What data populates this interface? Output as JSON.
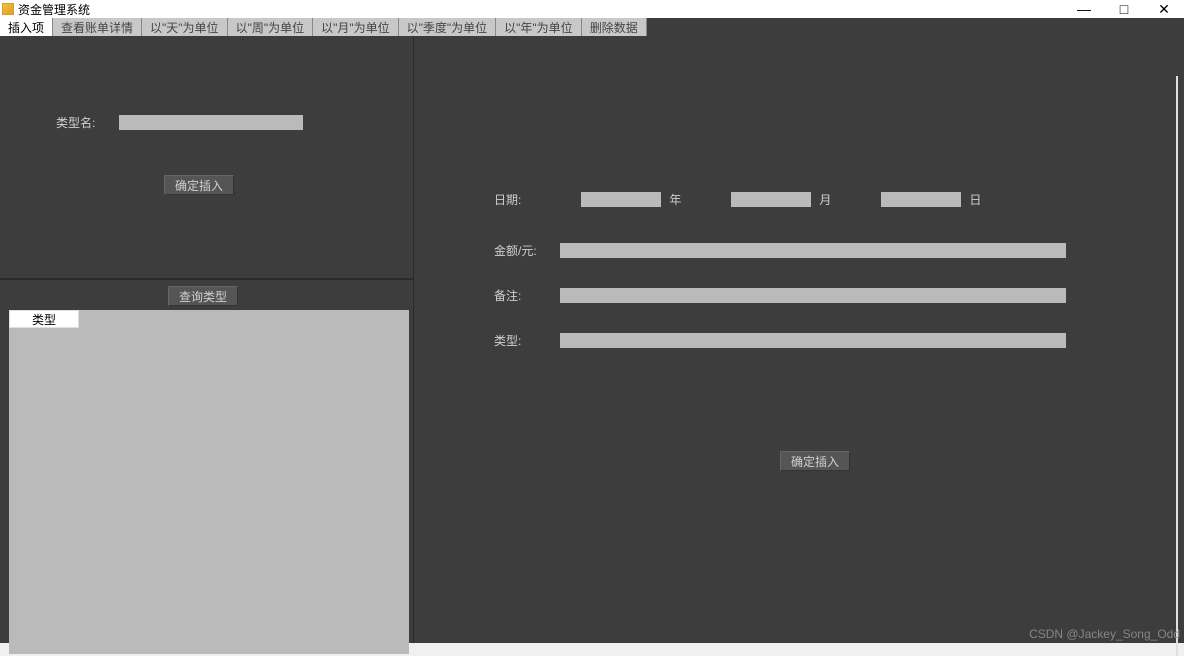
{
  "window": {
    "title": "资金管理系统",
    "controls": {
      "minimize": "—",
      "maximize": "□",
      "close": "✕"
    }
  },
  "tabs": [
    {
      "label": "插入项",
      "active": true
    },
    {
      "label": "查看账单详情",
      "active": false
    },
    {
      "label": "以\"天\"为单位",
      "active": false
    },
    {
      "label": "以\"周\"为单位",
      "active": false
    },
    {
      "label": "以\"月\"为单位",
      "active": false
    },
    {
      "label": "以\"季度\"为单位",
      "active": false
    },
    {
      "label": "以\"年\"为单位",
      "active": false
    },
    {
      "label": "删除数据",
      "active": false
    }
  ],
  "left_upper": {
    "type_name_label": "类型名:",
    "type_name_value": "",
    "confirm_insert_label": "确定插入"
  },
  "left_lower": {
    "query_type_label": "查询类型",
    "list_header": "类型",
    "list_items": []
  },
  "right_form": {
    "date_label": "日期:",
    "year_value": "",
    "year_unit": "年",
    "month_value": "",
    "month_unit": "月",
    "day_value": "",
    "day_unit": "日",
    "amount_label": "金额/元:",
    "amount_value": "",
    "note_label": "备注:",
    "note_value": "",
    "type_label": "类型:",
    "type_value": "",
    "confirm_insert_label": "确定插入"
  },
  "watermark": "CSDN @Jackey_Song_Odd"
}
